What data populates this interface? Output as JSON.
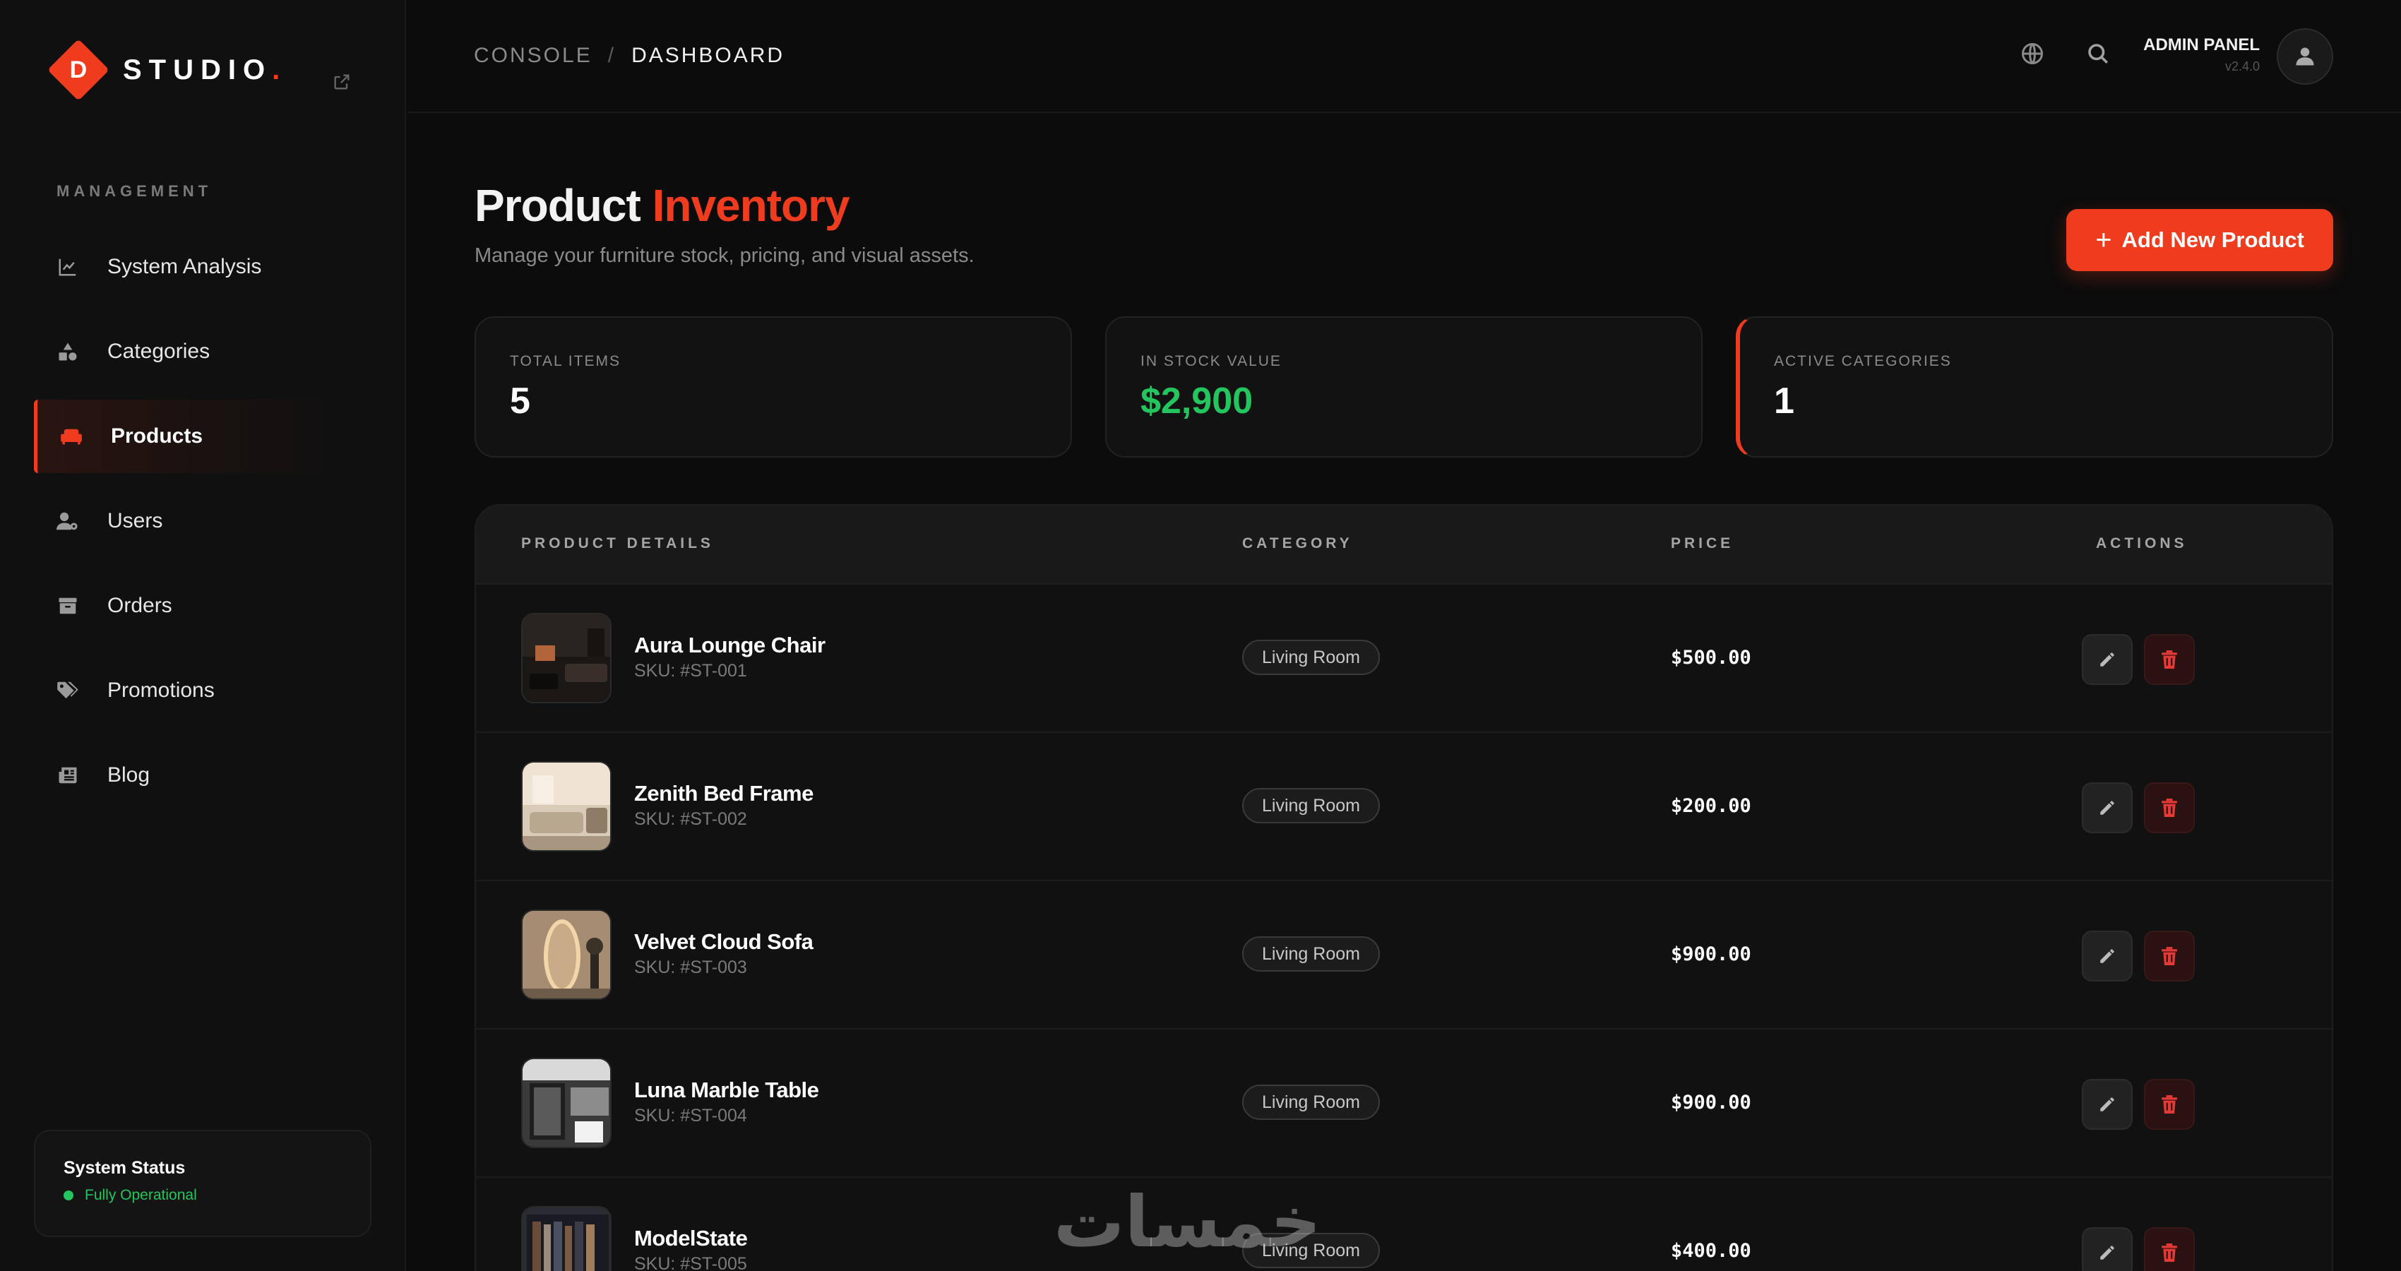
{
  "brand": {
    "letter": "D",
    "name": "STUDIO",
    "dot": "."
  },
  "sidebar": {
    "section_label": "MANAGEMENT",
    "items": [
      {
        "label": "System Analysis",
        "icon": "chart-line-icon"
      },
      {
        "label": "Categories",
        "icon": "shapes-icon"
      },
      {
        "label": "Products",
        "icon": "sofa-icon",
        "active": true
      },
      {
        "label": "Users",
        "icon": "users-gear-icon"
      },
      {
        "label": "Orders",
        "icon": "archive-box-icon"
      },
      {
        "label": "Promotions",
        "icon": "tags-icon"
      },
      {
        "label": "Blog",
        "icon": "newspaper-icon"
      }
    ],
    "status": {
      "title": "System Status",
      "text": "Fully Operational"
    }
  },
  "header": {
    "breadcrumb": {
      "first": "CONSOLE",
      "separator": "/",
      "second": "DASHBOARD"
    },
    "admin": {
      "name": "ADMIN PANEL",
      "version": "v2.4.0"
    }
  },
  "page": {
    "title_main": "Product",
    "title_accent": "Inventory",
    "subtitle": "Manage your furniture stock, pricing, and visual assets.",
    "add_button": "Add New Product"
  },
  "stats": [
    {
      "label": "TOTAL ITEMS",
      "value": "5"
    },
    {
      "label": "IN STOCK VALUE",
      "value": "$2,900"
    },
    {
      "label": "ACTIVE CATEGORIES",
      "value": "1"
    }
  ],
  "table": {
    "headers": [
      "PRODUCT DETAILS",
      "CATEGORY",
      "PRICE",
      "ACTIONS"
    ],
    "rows": [
      {
        "name": "Aura Lounge Chair",
        "sku": "SKU: #ST-001",
        "category": "Living Room",
        "price": "$500.00"
      },
      {
        "name": "Zenith Bed Frame",
        "sku": "SKU: #ST-002",
        "category": "Living Room",
        "price": "$200.00"
      },
      {
        "name": "Velvet Cloud Sofa",
        "sku": "SKU: #ST-003",
        "category": "Living Room",
        "price": "$900.00"
      },
      {
        "name": "Luna Marble Table",
        "sku": "SKU: #ST-004",
        "category": "Living Room",
        "price": "$900.00"
      },
      {
        "name": "ModelState",
        "sku": "SKU: #ST-005",
        "category": "Living Room",
        "price": "$400.00"
      }
    ]
  },
  "watermark": "خمسات",
  "colors": {
    "accent": "#f03c1e",
    "success": "#22c55e",
    "background": "#0c0c0c"
  }
}
